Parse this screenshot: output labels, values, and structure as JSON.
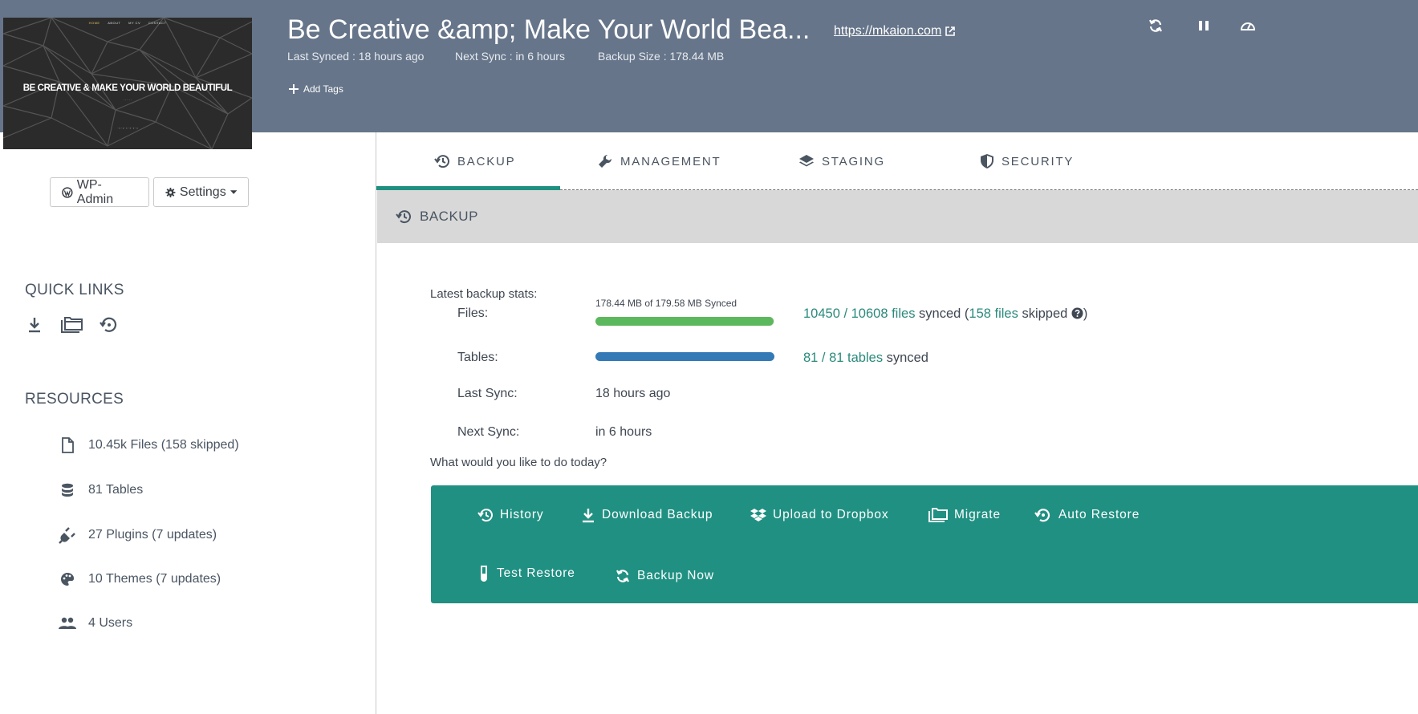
{
  "header": {
    "site_title": "Be Creative &amp; Make Your World Bea...",
    "site_url": "https://mkaion.com",
    "last_synced": "Last Synced : 18 hours ago",
    "next_sync": "Next Sync : in 6 hours",
    "backup_size": "Backup Size : 178.44 MB",
    "add_tags": "Add Tags",
    "icons": [
      "sync-icon",
      "pause-icon",
      "dashboard-icon"
    ]
  },
  "thumbnail": {
    "nav": [
      "HOME",
      "ABOUT",
      "MY CV",
      "CONTACT"
    ],
    "title": "BE CREATIVE & MAKE YOUR WORLD BEAUTIFUL"
  },
  "sidebar": {
    "wp_admin": "WP-Admin",
    "settings": "Settings",
    "quick_links_title": "QUICK LINKS",
    "resources_title": "RESOURCES",
    "resources": [
      {
        "icon": "file-icon",
        "label": "10.45k Files (158 skipped)"
      },
      {
        "icon": "database-icon",
        "label": "81 Tables"
      },
      {
        "icon": "plug-icon",
        "label": "27 Plugins (7 updates)"
      },
      {
        "icon": "palette-icon",
        "label": "10 Themes (7 updates)"
      },
      {
        "icon": "users-icon",
        "label": "4 Users"
      }
    ]
  },
  "tabs": [
    {
      "label": "BACKUP",
      "icon": "history-icon",
      "active": true
    },
    {
      "label": "MANAGEMENT",
      "icon": "wrench-icon",
      "active": false
    },
    {
      "label": "STAGING",
      "icon": "layers-icon",
      "active": false
    },
    {
      "label": "SECURITY",
      "icon": "shield-icon",
      "active": false
    }
  ],
  "panel": {
    "title": "BACKUP",
    "latest_stats_label": "Latest backup stats:",
    "files_label": "Files:",
    "files_sync_caption": "178.44 MB of 179.58 MB Synced",
    "files_progress": 0.994,
    "files_synced_count": "10450 / 10608 files",
    "files_synced_word": " synced (",
    "files_skipped_count": "158 files",
    "files_skipped_word": " skipped ",
    "files_close": ")",
    "tables_label": "Tables:",
    "tables_progress": 1.0,
    "tables_count": "81 / 81 tables",
    "tables_synced_word": " synced",
    "last_sync_label": "Last Sync:",
    "last_sync_value": "18 hours ago",
    "next_sync_label": "Next Sync:",
    "next_sync_value": "in 6 hours",
    "prompt": "What would you like to do today?"
  },
  "actions": {
    "history": "History",
    "download_backup": "Download Backup",
    "upload_dropbox": "Upload to Dropbox",
    "migrate": "Migrate",
    "auto_restore": "Auto Restore",
    "test_restore": "Test Restore",
    "backup_now": "Backup Now"
  },
  "colors": {
    "header_bg": "#66758a",
    "accent": "#209082",
    "files_bar": "#5cb85c",
    "tables_bar": "#337ab7"
  }
}
